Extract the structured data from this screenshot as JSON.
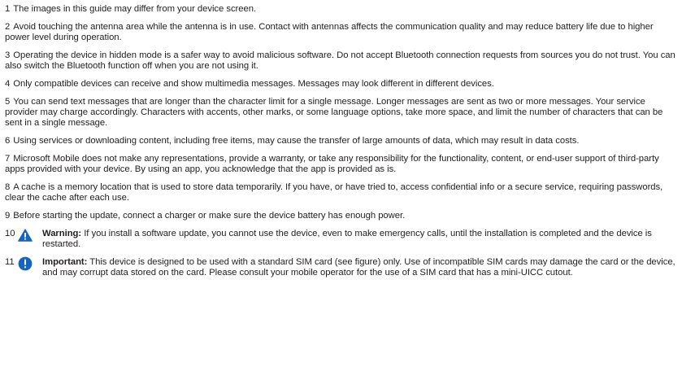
{
  "notes": [
    {
      "number": "1",
      "text": "The images in this guide may differ from your device screen."
    },
    {
      "number": "2",
      "text": "Avoid touching the antenna area while the antenna is in use. Contact with antennas affects the communication quality and may reduce battery life due to higher power level during operation."
    },
    {
      "number": "3",
      "text": "Operating the device in hidden mode is a safer way to avoid malicious software. Do not accept Bluetooth connection requests from sources you do not trust. You can also switch the Bluetooth function off when you are not using it."
    },
    {
      "number": "4",
      "text": "Only compatible devices can receive and show multimedia messages. Messages may look different in different devices."
    },
    {
      "number": "5",
      "text": "You can send text messages that are longer than the character limit for a single message. Longer messages are sent as two or more messages. Your service provider may charge accordingly. Characters with accents, other marks, or some language options, take more space, and limit the number of characters that can be sent in a single message."
    },
    {
      "number": "6",
      "text": "Using services or downloading content, including free items, may cause the transfer of large amounts of data, which may result in data costs."
    },
    {
      "number": "7",
      "text": "Microsoft Mobile does not make any representations, provide a warranty, or take any responsibility for the functionality, content, or end-user support of third-party apps provided with your device. By using an app, you acknowledge that the app is provided as is."
    },
    {
      "number": "8",
      "text": "A cache is a memory location that is used to store data temporarily. If you have, or have tried to, access confidential info or a secure service, requiring passwords, clear the cache after each use."
    },
    {
      "number": "9",
      "text": "Before starting the update, connect a charger or make sure the device battery has enough power."
    }
  ],
  "callouts": [
    {
      "number": "10",
      "icon": "warning-triangle-icon",
      "label": "Warning:",
      "text": "If you install a software update, you cannot use the device, even to make emergency calls, until the installation is completed and the device is restarted."
    },
    {
      "number": "11",
      "icon": "important-exclamation-icon",
      "label": "Important:",
      "text": "This device is designed to be used with a standard SIM card (see figure) only. Use of incompatible SIM cards may damage the card or the device, and may corrupt data stored on the card. Please consult your mobile operator for the use of a SIM card that has a mini-UICC cutout."
    }
  ],
  "colors": {
    "text": "#231f20",
    "icon": "#1565c0"
  }
}
